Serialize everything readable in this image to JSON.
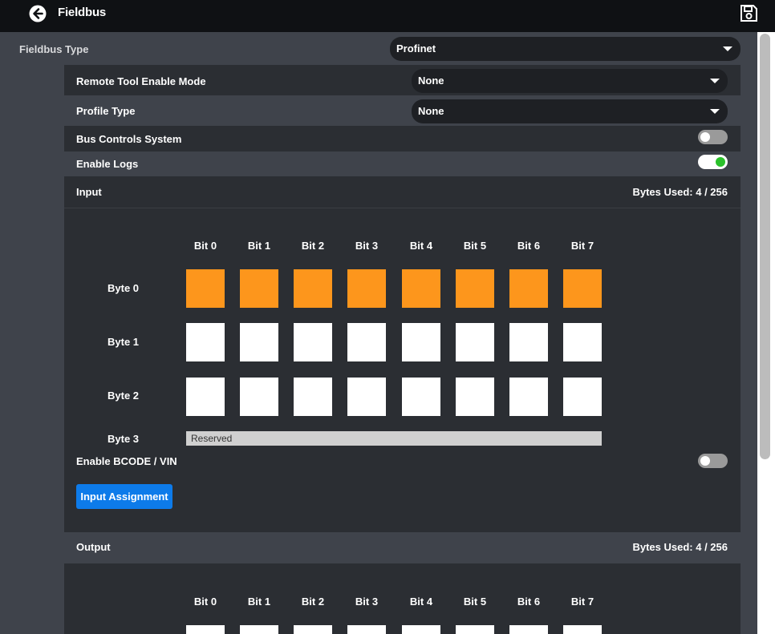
{
  "header": {
    "title": "Fieldbus"
  },
  "fieldbus_type": {
    "label": "Fieldbus Type",
    "value": "Profinet"
  },
  "settings": {
    "remote_tool_enable_mode": {
      "label": "Remote Tool Enable Mode",
      "value": "None"
    },
    "profile_type": {
      "label": "Profile Type",
      "value": "None"
    },
    "bus_controls_system": {
      "label": "Bus Controls System",
      "enabled": false
    },
    "enable_logs": {
      "label": "Enable Logs",
      "enabled": true
    }
  },
  "input": {
    "title": "Input",
    "bytes_used": "Bytes Used: 4 / 256",
    "bits": [
      "Bit 0",
      "Bit 1",
      "Bit 2",
      "Bit 3",
      "Bit 4",
      "Bit 5",
      "Bit 6",
      "Bit 7"
    ],
    "bytes": [
      {
        "label": "Byte 0",
        "state": [
          1,
          1,
          1,
          1,
          1,
          1,
          1,
          1
        ]
      },
      {
        "label": "Byte 1",
        "state": [
          0,
          0,
          0,
          0,
          0,
          0,
          0,
          0
        ]
      },
      {
        "label": "Byte 2",
        "state": [
          0,
          0,
          0,
          0,
          0,
          0,
          0,
          0
        ]
      }
    ],
    "byte3": {
      "label": "Byte 3",
      "text": "Reserved"
    },
    "enable_bcode": {
      "label": "Enable BCODE / VIN",
      "enabled": false
    },
    "assign_button": "Input Assignment"
  },
  "output": {
    "title": "Output",
    "bytes_used": "Bytes Used: 4 / 256",
    "bits": [
      "Bit 0",
      "Bit 1",
      "Bit 2",
      "Bit 3",
      "Bit 4",
      "Bit 5",
      "Bit 6",
      "Bit 7"
    ]
  },
  "colors": {
    "active_bit": "#fd961c",
    "accent": "#0d7bea",
    "toggle_on": "#2bc12b"
  },
  "icons": {
    "back": "arrow-left-circle-icon",
    "save": "floppy-disk-icon"
  }
}
